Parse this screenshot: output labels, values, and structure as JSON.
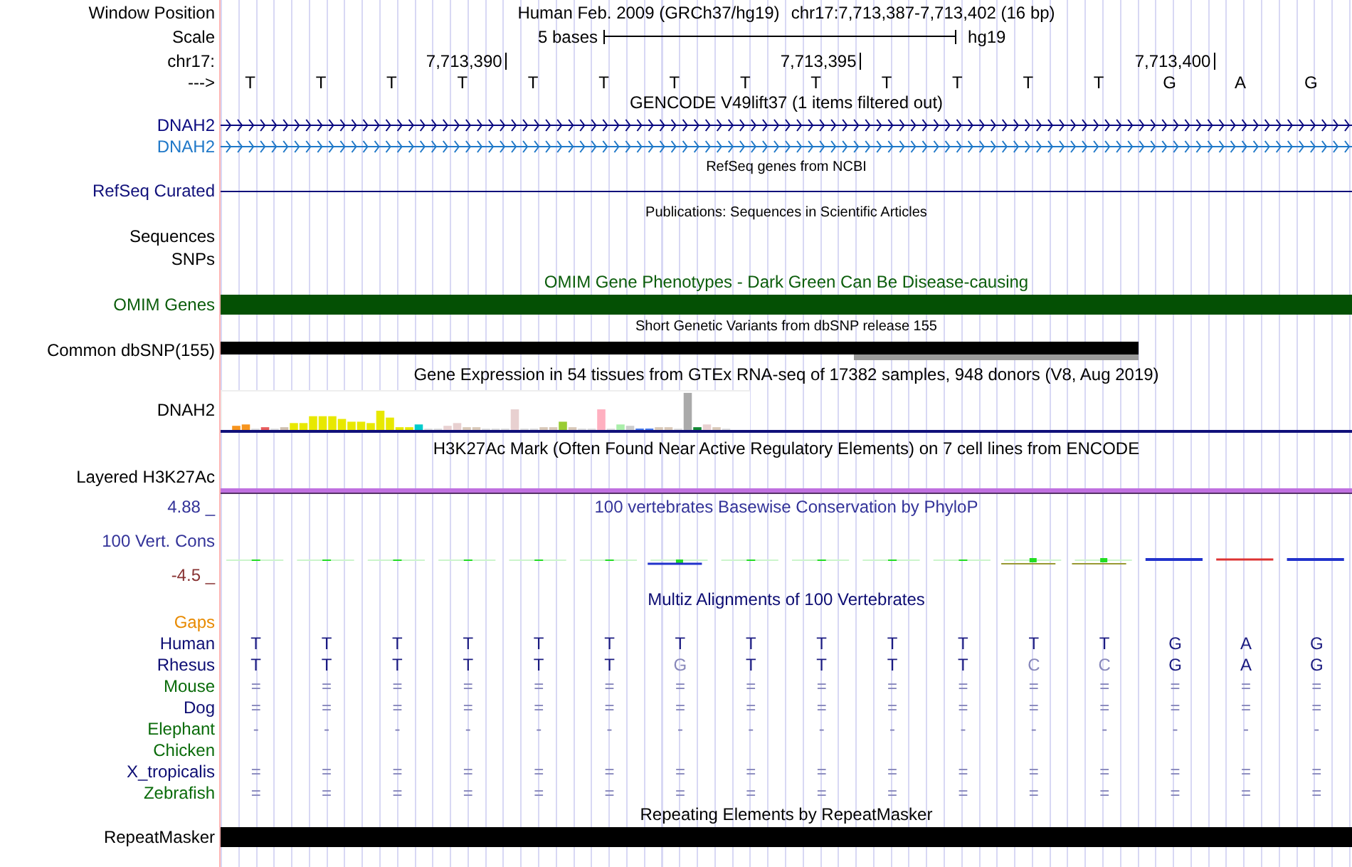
{
  "ruler": {
    "position_label": "Window Position",
    "assembly": "Human Feb. 2009 (GRCh37/hg19)",
    "position": "chr17:7,713,387-7,713,402 (16 bp)",
    "scale_label": "Scale",
    "scale_text": "5 bases",
    "scale_db": "hg19",
    "chrom_label": "chr17:",
    "strand_label": "--->",
    "bases": [
      {
        "base": "T"
      },
      {
        "base": "T"
      },
      {
        "base": "T"
      },
      {
        "base": "T",
        "tick": "7,713,390"
      },
      {
        "base": "T"
      },
      {
        "base": "T"
      },
      {
        "base": "T"
      },
      {
        "base": "T"
      },
      {
        "base": "T",
        "tick": "7,713,395"
      },
      {
        "base": "T"
      },
      {
        "base": "T"
      },
      {
        "base": "T"
      },
      {
        "base": "T"
      },
      {
        "base": "G",
        "tick": "7,713,400"
      },
      {
        "base": "A"
      },
      {
        "base": "G"
      }
    ]
  },
  "tracks": [
    {
      "kind": "gene",
      "title": "GENCODE V49lift37 (1 items filtered out)",
      "rows": [
        {
          "label": "DNAH2",
          "color": "#0a0a80"
        },
        {
          "label": "DNAH2",
          "color": "#1f78c8"
        }
      ]
    },
    {
      "kind": "line",
      "title": "RefSeq genes from NCBI",
      "rows": [
        {
          "label": "RefSeq Curated",
          "color": "#10107a"
        }
      ]
    },
    {
      "kind": "empty",
      "title": "Publications: Sequences in Scientific Articles",
      "rows": [
        {
          "label": "Sequences",
          "color": "#000000"
        },
        {
          "label": "SNPs",
          "color": "#000000"
        }
      ]
    },
    {
      "kind": "bar",
      "title": "OMIM Gene Phenotypes - Dark Green Can Be Disease-causing",
      "rows": [
        {
          "label": "OMIM Genes",
          "color": "#0b5d0b"
        }
      ]
    },
    {
      "kind": "snp",
      "title": "Short Genetic Variants from dbSNP release 155",
      "rows": [
        {
          "label": "Common dbSNP(155)",
          "color": "#000000"
        }
      ]
    },
    {
      "kind": "expression",
      "title": "Gene Expression in 54 tissues from GTEx RNA-seq of 17382 samples, 948 donors (V8, Aug 2019)",
      "rows": [
        {
          "label": "DNAH2",
          "color": "#000000"
        }
      ]
    },
    {
      "kind": "signal",
      "title": "H3K27Ac Mark (Often Found Near Active Regulatory Elements) on 7 cell lines from ENCODE",
      "rows": [
        {
          "label": "Layered H3K27Ac",
          "color": "#000000"
        }
      ]
    },
    {
      "kind": "conservation",
      "title": "100 vertebrates Basewise Conservation by PhyloP",
      "max": "4.88 _",
      "min": "-4.5 _",
      "rows": [
        {
          "label": "100 Vert. Cons",
          "color": "#333399"
        }
      ]
    },
    {
      "kind": "alignment",
      "title": "Multiz Alignments of 100 Vertebrates",
      "gaps_label": "Gaps",
      "species": [
        {
          "label": "Human",
          "color": "#0d0d73",
          "bases": [
            "T",
            "T",
            "T",
            "T",
            "T",
            "T",
            "T",
            "T",
            "T",
            "T",
            "T",
            "T",
            "T",
            "G",
            "A",
            "G"
          ]
        },
        {
          "label": "Rhesus",
          "color": "#0d0d73",
          "bases": [
            "T",
            "T",
            "T",
            "T",
            "T",
            "T",
            "G",
            "T",
            "T",
            "T",
            "T",
            "C",
            "C",
            "G",
            "A",
            "G"
          ]
        },
        {
          "label": "Mouse",
          "color": "#0a6b0a",
          "bases": [
            "=",
            "=",
            "=",
            "=",
            "=",
            "=",
            "=",
            "=",
            "=",
            "=",
            "=",
            "=",
            "=",
            "=",
            "=",
            "="
          ]
        },
        {
          "label": "Dog",
          "color": "#0d0d73",
          "bases": [
            "=",
            "=",
            "=",
            "=",
            "=",
            "=",
            "=",
            "=",
            "=",
            "=",
            "=",
            "=",
            "=",
            "=",
            "=",
            "="
          ]
        },
        {
          "label": "Elephant",
          "color": "#0a6b0a",
          "bases": [
            "-",
            "-",
            "-",
            "-",
            "-",
            "-",
            "-",
            "-",
            "-",
            "-",
            "-",
            "-",
            "-",
            "-",
            "-",
            "-"
          ]
        },
        {
          "label": "Chicken",
          "color": "#0a6b0a"
        },
        {
          "label": "X_tropicalis",
          "color": "#0d0d73",
          "bases": [
            "=",
            "=",
            "=",
            "=",
            "=",
            "=",
            "=",
            "=",
            "=",
            "=",
            "=",
            "=",
            "=",
            "=",
            "=",
            "="
          ]
        },
        {
          "label": "Zebrafish",
          "color": "#0a6b0a",
          "bases": [
            "=",
            "=",
            "=",
            "=",
            "=",
            "=",
            "=",
            "=",
            "=",
            "=",
            "=",
            "=",
            "=",
            "=",
            "=",
            "="
          ]
        }
      ]
    },
    {
      "kind": "bar",
      "title": "Repeating Elements by RepeatMasker",
      "rows": [
        {
          "label": "RepeatMasker",
          "color": "#000000"
        }
      ]
    }
  ]
}
